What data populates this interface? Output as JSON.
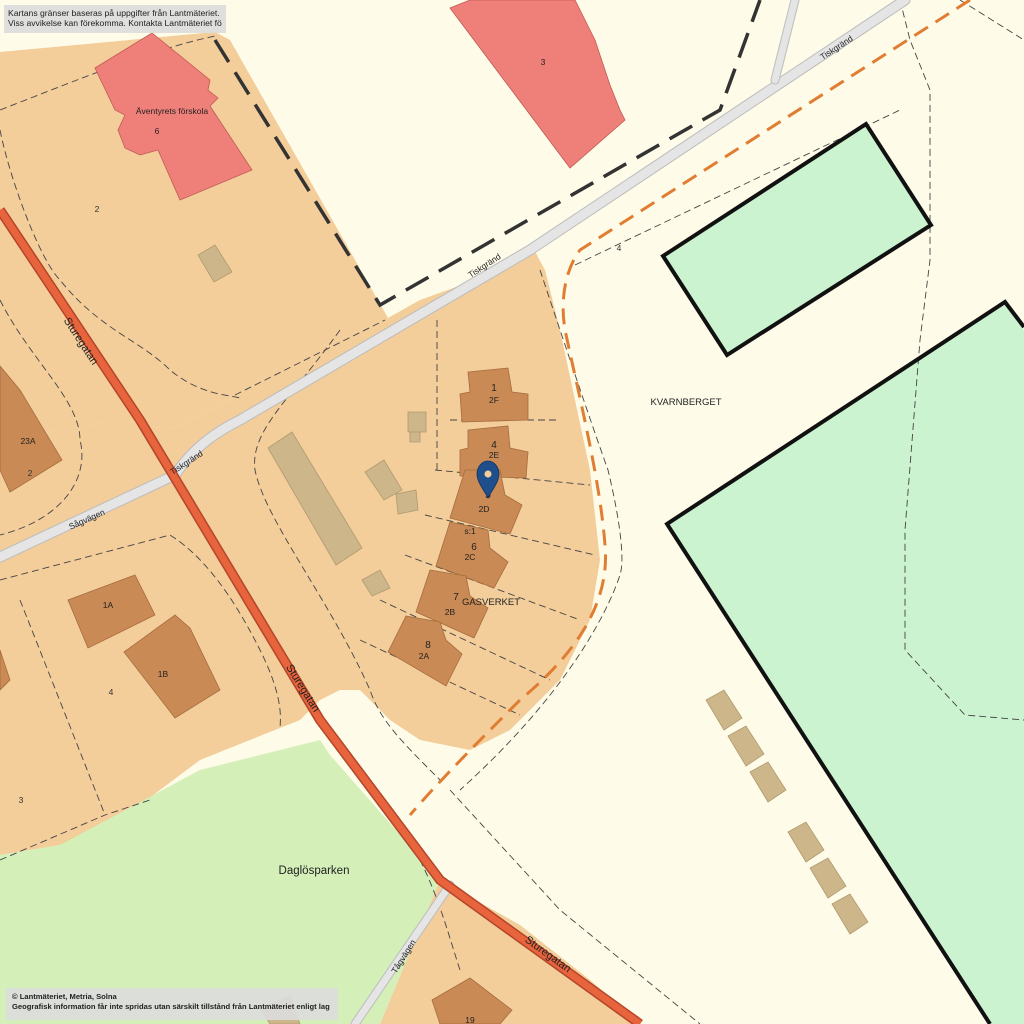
{
  "map": {
    "notice_lines": [
      "Kartans gränser baseras på uppgifter från Lantmäteriet.",
      "Viss avvikelse kan förekomma. Kontakta Lantmäteriet för mer information."
    ],
    "copyright_lines": [
      "© Lantmäteriet, Metria, Solna",
      "Geografisk information får inte spridas utan särskilt tillstånd från Lantmäteriet enligt lag (2016:319)"
    ],
    "area_labels": {
      "kvarnberget": "KVARNBERGET",
      "gasverket": "GASVERKET",
      "daglosparken": "Daglösparken"
    },
    "street_labels": {
      "sturegatan": "Sturegatan",
      "tiskgrand": "Tiskgränd",
      "sagvagen": "Sågvägen",
      "tagvagen": "Tågvägen"
    },
    "poi_labels": {
      "forskola": "Äventyrets förskola"
    },
    "building_numbers": {
      "b1": "1",
      "b1_addr": "2F",
      "b4": "4",
      "b4_addr": "2E",
      "b5": "5",
      "b5_addr": "2D",
      "b6": "6",
      "b6_addr": "2C",
      "b7": "7",
      "b7_addr": "2B",
      "b8": "8",
      "b8_addr": "2A",
      "sub": "s:1",
      "b1A": "1A",
      "b1B": "1B",
      "b23A": "23A",
      "b19": "19",
      "school_no": "6",
      "red3": "3"
    },
    "parcel_numbers": {
      "p2_top": "2",
      "p2_left": "2",
      "p4_left": "4",
      "p3_left": "3",
      "p4_east": "4"
    },
    "marker": {
      "icon": "map-pin-icon",
      "color": "#1f4e8c"
    },
    "colors": {
      "background": "#fefce8",
      "residential": "#f3cd9a",
      "building_brown": "#c98a55",
      "building_red": "#ef8079",
      "park_green": "#d4efb8",
      "open_green": "#ccf3d0",
      "main_road": "#e8643c",
      "small_road": "#e5e5e5",
      "boundary_orange": "#e07d32",
      "minor_building": "#cdb68a"
    }
  }
}
